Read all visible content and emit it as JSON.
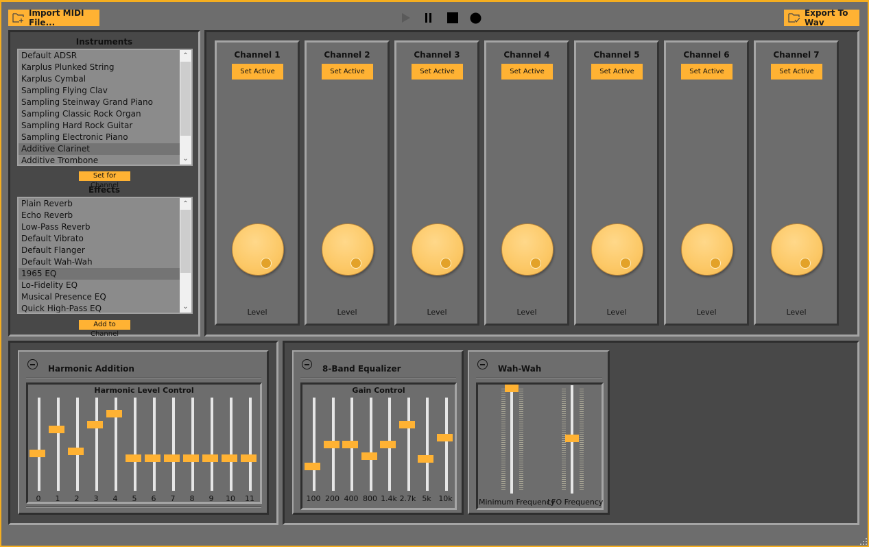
{
  "toolbar": {
    "import_label": "Import MIDI File...",
    "export_label": "Export To Wav",
    "import_icon": "folder-add-icon",
    "export_icon": "folder-check-icon",
    "transport": [
      {
        "name": "play-icon",
        "enabled": false
      },
      {
        "name": "pause-icon",
        "enabled": true
      },
      {
        "name": "stop-icon",
        "enabled": true
      },
      {
        "name": "record-icon",
        "enabled": true
      }
    ]
  },
  "instruments": {
    "title": "Instruments",
    "items": [
      "Default ADSR",
      "Karplus Plunked String",
      "Karplus Cymbal",
      "Sampling Flying Clav",
      "Sampling Steinway Grand Piano",
      "Sampling Classic Rock Organ",
      "Sampling Hard Rock Guitar",
      "Sampling Electronic Piano",
      "Additive Clarinet",
      "Additive Trombone"
    ],
    "selected_index": 8,
    "button_label": "Set for Channel"
  },
  "effects": {
    "title": "Effects",
    "items": [
      "Plain Reverb",
      "Echo Reverb",
      "Low-Pass Reverb",
      "Default Vibrato",
      "Default Flanger",
      "Default Wah-Wah",
      "1965 EQ",
      "Lo-Fidelity EQ",
      "Musical Presence EQ",
      "Quick High-Pass EQ"
    ],
    "selected_index": 6,
    "button_label": "Add to Channel"
  },
  "channels": [
    {
      "title": "Channel 1",
      "button": "Set Active",
      "knob_label": "Level"
    },
    {
      "title": "Channel 2",
      "button": "Set Active",
      "knob_label": "Level"
    },
    {
      "title": "Channel 3",
      "button": "Set Active",
      "knob_label": "Level"
    },
    {
      "title": "Channel 4",
      "button": "Set Active",
      "knob_label": "Level"
    },
    {
      "title": "Channel 5",
      "button": "Set Active",
      "knob_label": "Level"
    },
    {
      "title": "Channel 6",
      "button": "Set Active",
      "knob_label": "Level"
    },
    {
      "title": "Channel 7",
      "button": "Set Active",
      "knob_label": "Level"
    }
  ],
  "harmonic": {
    "title": "Harmonic Addition",
    "group_title": "Harmonic Level Control",
    "sliders": [
      {
        "label": "0",
        "value": 0.4
      },
      {
        "label": "1",
        "value": 0.66
      },
      {
        "label": "2",
        "value": 0.42
      },
      {
        "label": "3",
        "value": 0.71
      },
      {
        "label": "4",
        "value": 0.83
      },
      {
        "label": "5",
        "value": 0.35
      },
      {
        "label": "6",
        "value": 0.35
      },
      {
        "label": "7",
        "value": 0.35
      },
      {
        "label": "8",
        "value": 0.35
      },
      {
        "label": "9",
        "value": 0.35
      },
      {
        "label": "10",
        "value": 0.35
      },
      {
        "label": "11",
        "value": 0.35
      }
    ]
  },
  "equalizer": {
    "title": "8-Band Equalizer",
    "group_title": "Gain Control",
    "sliders": [
      {
        "label": "100",
        "value": 0.26
      },
      {
        "label": "200",
        "value": 0.5
      },
      {
        "label": "400",
        "value": 0.5
      },
      {
        "label": "800",
        "value": 0.375
      },
      {
        "label": "1.4k",
        "value": 0.5
      },
      {
        "label": "2.7k",
        "value": 0.71
      },
      {
        "label": "5k",
        "value": 0.34
      },
      {
        "label": "10k",
        "value": 0.57
      }
    ]
  },
  "wahwah": {
    "title": "Wah-Wah",
    "sliders": [
      {
        "label": "Minimum Frequency",
        "value": 0.98
      },
      {
        "label": "LFO Frequency",
        "value": 0.52
      }
    ]
  },
  "colors": {
    "accent": "#ffb233",
    "frame": "#f5ae1f",
    "background": "#6d6d6d",
    "panel": "#484848"
  }
}
